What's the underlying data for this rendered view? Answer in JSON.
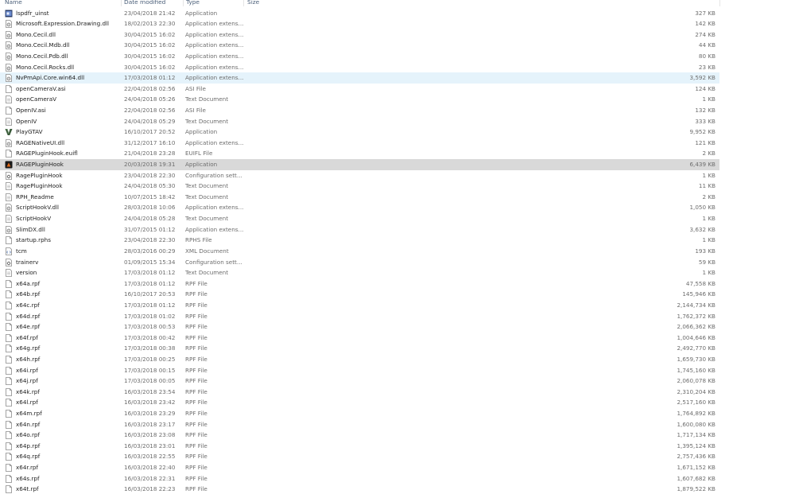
{
  "header": {
    "name": "Name",
    "date": "Date modified",
    "type": "Type",
    "size": "Size"
  },
  "files": [
    {
      "name": "lspdfr_uinst",
      "date": "23/04/2018 21:42",
      "type": "Application",
      "size": "327 KB",
      "icon": "app-exe-icon"
    },
    {
      "name": "Microsoft.Expression.Drawing.dll",
      "date": "18/02/2013 22:30",
      "type": "Application extens...",
      "size": "142 KB",
      "icon": "dll-icon"
    },
    {
      "name": "Mono.Cecil.dll",
      "date": "30/04/2015 16:02",
      "type": "Application extens...",
      "size": "274 KB",
      "icon": "dll-icon"
    },
    {
      "name": "Mono.Cecil.Mdb.dll",
      "date": "30/04/2015 16:02",
      "type": "Application extens...",
      "size": "44 KB",
      "icon": "dll-icon"
    },
    {
      "name": "Mono.Cecil.Pdb.dll",
      "date": "30/04/2015 16:02",
      "type": "Application extens...",
      "size": "80 KB",
      "icon": "dll-icon"
    },
    {
      "name": "Mono.Cecil.Rocks.dll",
      "date": "30/04/2015 16:02",
      "type": "Application extens...",
      "size": "23 KB",
      "icon": "dll-icon"
    },
    {
      "name": "NvPmApi.Core.win64.dll",
      "date": "17/03/2018 01:12",
      "type": "Application extens...",
      "size": "3,592 KB",
      "icon": "dll-icon"
    },
    {
      "name": "openCameraV.asi",
      "date": "22/04/2018 02:56",
      "type": "ASI File",
      "size": "124 KB",
      "icon": "blank-file-icon"
    },
    {
      "name": "openCameraV",
      "date": "24/04/2018 05:26",
      "type": "Text Document",
      "size": "1 KB",
      "icon": "text-file-icon"
    },
    {
      "name": "OpenIV.asi",
      "date": "22/04/2018 02:56",
      "type": "ASI File",
      "size": "132 KB",
      "icon": "blank-file-icon"
    },
    {
      "name": "OpenIV",
      "date": "24/04/2018 05:29",
      "type": "Text Document",
      "size": "333 KB",
      "icon": "text-file-icon"
    },
    {
      "name": "PlayGTAV",
      "date": "16/10/2017 20:52",
      "type": "Application",
      "size": "9,952 KB",
      "icon": "gtav-app-icon"
    },
    {
      "name": "RAGENativeUI.dll",
      "date": "31/12/2017 16:10",
      "type": "Application extens...",
      "size": "121 KB",
      "icon": "dll-icon"
    },
    {
      "name": "RAGEPluginHook.euifl",
      "date": "21/04/2018 23:28",
      "type": "EUIFL File",
      "size": "2 KB",
      "icon": "blank-file-icon"
    },
    {
      "name": "RAGEPluginHook",
      "date": "20/03/2018 19:31",
      "type": "Application",
      "size": "6,439 KB",
      "icon": "rph-app-icon"
    },
    {
      "name": "RagePluginHook",
      "date": "23/04/2018 22:30",
      "type": "Configuration sett...",
      "size": "1 KB",
      "icon": "config-file-icon"
    },
    {
      "name": "RagePluginHook",
      "date": "24/04/2018 05:30",
      "type": "Text Document",
      "size": "11 KB",
      "icon": "text-file-icon"
    },
    {
      "name": "RPH_Readme",
      "date": "10/07/2015 18:42",
      "type": "Text Document",
      "size": "2 KB",
      "icon": "text-file-icon"
    },
    {
      "name": "ScriptHookV.dll",
      "date": "28/03/2018 10:06",
      "type": "Application extens...",
      "size": "1,050 KB",
      "icon": "dll-icon"
    },
    {
      "name": "ScriptHookV",
      "date": "24/04/2018 05:28",
      "type": "Text Document",
      "size": "1 KB",
      "icon": "text-file-icon"
    },
    {
      "name": "SlimDX.dll",
      "date": "31/07/2015 01:12",
      "type": "Application extens...",
      "size": "3,632 KB",
      "icon": "dll-icon"
    },
    {
      "name": "startup.rphs",
      "date": "23/04/2018 22:30",
      "type": "RPHS File",
      "size": "1 KB",
      "icon": "blank-file-icon"
    },
    {
      "name": "tcm",
      "date": "28/03/2016 00:29",
      "type": "XML Document",
      "size": "193 KB",
      "icon": "xml-file-icon"
    },
    {
      "name": "trainerv",
      "date": "01/09/2015 15:34",
      "type": "Configuration sett...",
      "size": "59 KB",
      "icon": "config-file-icon"
    },
    {
      "name": "version",
      "date": "17/03/2018 01:12",
      "type": "Text Document",
      "size": "1 KB",
      "icon": "text-file-icon"
    },
    {
      "name": "x64a.rpf",
      "date": "17/03/2018 01:12",
      "type": "RPF File",
      "size": "47,558 KB",
      "icon": "blank-file-icon"
    },
    {
      "name": "x64b.rpf",
      "date": "16/10/2017 20:53",
      "type": "RPF File",
      "size": "145,946 KB",
      "icon": "blank-file-icon"
    },
    {
      "name": "x64c.rpf",
      "date": "17/03/2018 01:12",
      "type": "RPF File",
      "size": "2,144,734 KB",
      "icon": "blank-file-icon"
    },
    {
      "name": "x64d.rpf",
      "date": "17/03/2018 01:02",
      "type": "RPF File",
      "size": "1,762,372 KB",
      "icon": "blank-file-icon"
    },
    {
      "name": "x64e.rpf",
      "date": "17/03/2018 00:53",
      "type": "RPF File",
      "size": "2,066,362 KB",
      "icon": "blank-file-icon"
    },
    {
      "name": "x64f.rpf",
      "date": "17/03/2018 00:42",
      "type": "RPF File",
      "size": "1,004,646 KB",
      "icon": "blank-file-icon"
    },
    {
      "name": "x64g.rpf",
      "date": "17/03/2018 00:38",
      "type": "RPF File",
      "size": "2,492,770 KB",
      "icon": "blank-file-icon"
    },
    {
      "name": "x64h.rpf",
      "date": "17/03/2018 00:25",
      "type": "RPF File",
      "size": "1,659,730 KB",
      "icon": "blank-file-icon"
    },
    {
      "name": "x64i.rpf",
      "date": "17/03/2018 00:15",
      "type": "RPF File",
      "size": "1,745,160 KB",
      "icon": "blank-file-icon"
    },
    {
      "name": "x64j.rpf",
      "date": "17/03/2018 00:05",
      "type": "RPF File",
      "size": "2,060,078 KB",
      "icon": "blank-file-icon"
    },
    {
      "name": "x64k.rpf",
      "date": "16/03/2018 23:54",
      "type": "RPF File",
      "size": "2,310,204 KB",
      "icon": "blank-file-icon"
    },
    {
      "name": "x64l.rpf",
      "date": "16/03/2018 23:42",
      "type": "RPF File",
      "size": "2,517,160 KB",
      "icon": "blank-file-icon"
    },
    {
      "name": "x64m.rpf",
      "date": "16/03/2018 23:29",
      "type": "RPF File",
      "size": "1,764,892 KB",
      "icon": "blank-file-icon"
    },
    {
      "name": "x64n.rpf",
      "date": "16/03/2018 23:17",
      "type": "RPF File",
      "size": "1,600,080 KB",
      "icon": "blank-file-icon"
    },
    {
      "name": "x64o.rpf",
      "date": "16/03/2018 23:08",
      "type": "RPF File",
      "size": "1,717,134 KB",
      "icon": "blank-file-icon"
    },
    {
      "name": "x64p.rpf",
      "date": "16/03/2018 23:01",
      "type": "RPF File",
      "size": "1,395,124 KB",
      "icon": "blank-file-icon"
    },
    {
      "name": "x64q.rpf",
      "date": "16/03/2018 22:55",
      "type": "RPF File",
      "size": "2,757,436 KB",
      "icon": "blank-file-icon"
    },
    {
      "name": "x64r.rpf",
      "date": "16/03/2018 22:40",
      "type": "RPF File",
      "size": "1,671,152 KB",
      "icon": "blank-file-icon"
    },
    {
      "name": "x64s.rpf",
      "date": "16/03/2018 22:31",
      "type": "RPF File",
      "size": "1,607,682 KB",
      "icon": "blank-file-icon"
    },
    {
      "name": "x64t.rpf",
      "date": "16/03/2018 22:23",
      "type": "RPF File",
      "size": "1,879,522 KB",
      "icon": "blank-file-icon"
    }
  ],
  "hovered_row": 6,
  "selected_row": 14,
  "colors": {
    "hover": "#e5f3fb",
    "selected": "#d9d9d9",
    "header_text": "#4c607a"
  }
}
